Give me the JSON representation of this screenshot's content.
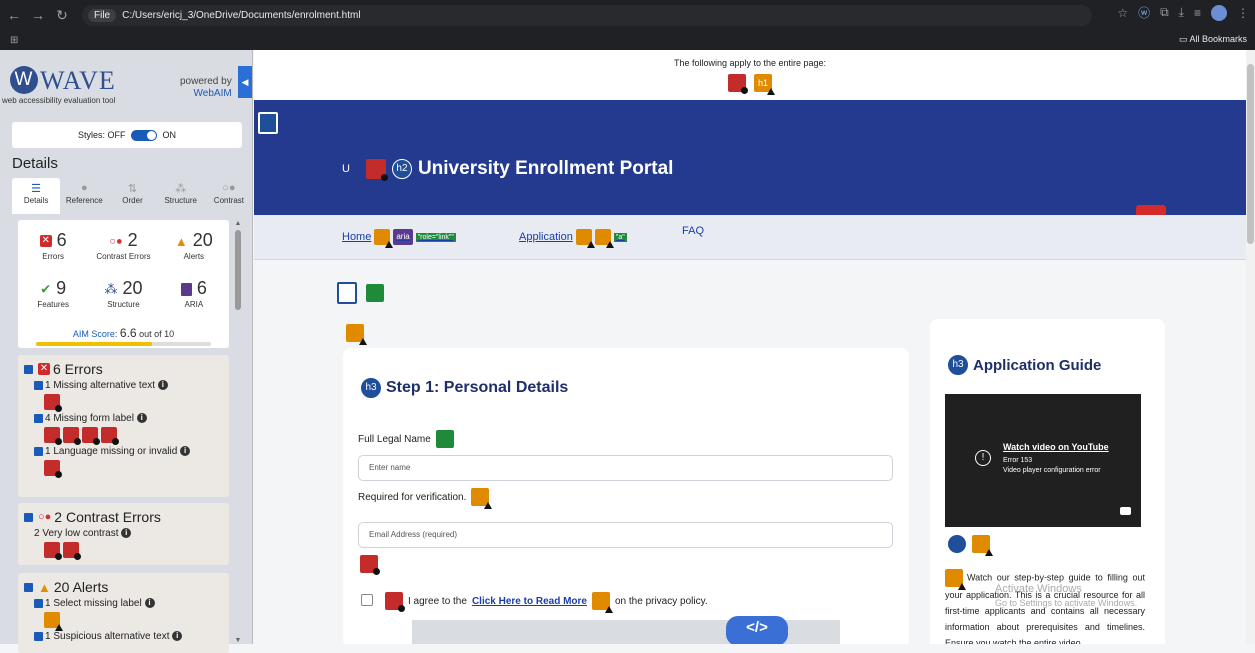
{
  "browser": {
    "url_chip": "File",
    "url": "C:/Users/ericj_3/OneDrive/Documents/enrolment.html",
    "bookmarks_label": "All Bookmarks"
  },
  "wave": {
    "logo_letter": "W",
    "logo_text": "WAVE",
    "tagline": "web accessibility evaluation tool",
    "powered_by": "powered by",
    "webaim_link": "WebAIM",
    "styles_label": "Styles:",
    "styles_off": "OFF",
    "styles_on": "ON",
    "details_heading": "Details",
    "tabs": [
      {
        "label": "Details",
        "icon": "☰"
      },
      {
        "label": "Reference",
        "icon": "●"
      },
      {
        "label": "Order",
        "icon": "⇅"
      },
      {
        "label": "Structure",
        "icon": "⁂"
      },
      {
        "label": "Contrast",
        "icon": "○●"
      }
    ],
    "summary": {
      "errors": {
        "count": "6",
        "label": "Errors"
      },
      "contrast": {
        "count": "2",
        "label": "Contrast Errors"
      },
      "alerts": {
        "count": "20",
        "label": "Alerts"
      },
      "features": {
        "count": "9",
        "label": "Features"
      },
      "structure": {
        "count": "20",
        "label": "Structure"
      },
      "aria": {
        "count": "6",
        "label": "ARIA"
      },
      "aim_label": "AIM Score",
      "aim_value": "6.6",
      "aim_suffix": "out of 10",
      "aim_fraction": 0.66
    },
    "errors_cat": {
      "title": "6 Errors",
      "items": [
        {
          "text": "1 Missing alternative text"
        },
        {
          "text": "4 Missing form label"
        },
        {
          "text": "1 Language missing or invalid"
        }
      ]
    },
    "contrast_cat": {
      "title": "2 Contrast Errors",
      "item": "2 Very low contrast"
    },
    "alerts_cat": {
      "title": "20 Alerts",
      "items": [
        {
          "text": "1 Select missing label"
        },
        {
          "text": "1 Suspicious alternative text"
        }
      ]
    }
  },
  "page": {
    "apply_text": "The following apply to the entire page:",
    "apply_badge_h1": "h1",
    "brand_letter": "U",
    "banner_heading_tag": "h2",
    "banner_title": "University Enrollment Portal",
    "close_symbol": "×",
    "nav": {
      "home": "Home",
      "aria_badge": "aria",
      "home_role_tag": "\"role=\"link\"\"",
      "application": "Application",
      "application_tag": "\"a\"",
      "faq": "FAQ"
    },
    "step": {
      "heading_tag": "h3",
      "title": "Step 1: Personal Details",
      "name_label": "Full Legal Name",
      "name_placeholder": "Enter name",
      "required_note": "Required for verification.",
      "email_placeholder": "Email Address (required)",
      "agree_prefix": "I agree to the",
      "agree_link": "Click Here to Read More",
      "agree_suffix": "on the privacy policy.",
      "code_symbol": "</>"
    },
    "guide": {
      "heading_tag": "h3",
      "title": "Application Guide",
      "video_link": "Watch video on YouTube",
      "video_error_code": "Error 153",
      "video_error_text": "Video player configuration error",
      "video_warn_symbol": "!",
      "text": "Watch our step-by-step guide to filling out your application. This is a crucial resource for all first-time applicants and contains all necessary information about prerequisites and timelines. Ensure you watch the entire video"
    }
  },
  "os": {
    "watermark_title": "Activate Windows",
    "watermark_sub": "Go to Settings to activate Windows."
  },
  "colors": {
    "banner": "#233a8f",
    "wave_blue": "#1a5ab8",
    "error_red": "#c42b2b",
    "alert_orange": "#e08a00"
  }
}
